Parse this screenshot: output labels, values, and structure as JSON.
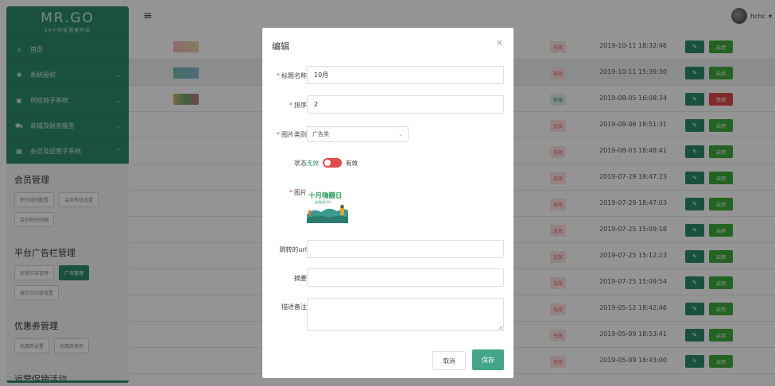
{
  "app": {
    "logo": "MR.GO",
    "tagline": "24小时智慧便利店"
  },
  "topbar": {
    "username": "hchc",
    "dropdown_glyph": "▾"
  },
  "sidebar": {
    "menu": [
      {
        "icon": "home-icon",
        "glyph": "⌂",
        "label": "首页",
        "chevron": ""
      },
      {
        "icon": "gear-icon",
        "glyph": "✱",
        "label": "系统授权",
        "chevron": "⌄"
      },
      {
        "icon": "box-icon",
        "glyph": "▣",
        "label": "供应链子系统",
        "chevron": "⌄"
      },
      {
        "icon": "cart-icon",
        "glyph": "⛟",
        "label": "商城及财务服务",
        "chevron": "⌄"
      },
      {
        "icon": "grid-icon",
        "glyph": "▦",
        "label": "会员及运营子系统",
        "chevron": "⌃"
      }
    ],
    "sections": [
      {
        "title": "会员管理",
        "items": [
          {
            "label": "积分规则配置",
            "active": false
          },
          {
            "label": "会员等级设置",
            "active": false
          },
          {
            "label": "会员积分明细",
            "active": false
          }
        ]
      },
      {
        "title": "平台广告栏管理",
        "items": [
          {
            "label": "运营栏目管理",
            "active": false
          },
          {
            "label": "广告管理",
            "active": true
          },
          {
            "label": "展示位内容设置",
            "active": false
          }
        ]
      },
      {
        "title": "优惠券管理",
        "items": [
          {
            "label": "优惠券设置",
            "active": false
          },
          {
            "label": "优惠券使用",
            "active": false
          }
        ]
      },
      {
        "title": "运营促销活动",
        "items": []
      }
    ]
  },
  "table": {
    "rows": [
      {
        "status": "无效",
        "status_type": "bad",
        "time": "2019-10-11 18:32:46",
        "action": "启用",
        "action_type": "green",
        "thumb": "pink"
      },
      {
        "status": "无效",
        "status_type": "bad",
        "time": "2019-10-11 15:39:30",
        "action": "启用",
        "action_type": "green",
        "thumb": "teal",
        "highlight": true
      },
      {
        "status": "有效",
        "status_type": "good",
        "time": "2019-08-05 16:08:34",
        "action": "禁用",
        "action_type": "red",
        "thumb": "multi"
      },
      {
        "status": "无效",
        "status_type": "bad",
        "time": "2019-08-06 18:51:31",
        "action": "启用",
        "action_type": "green"
      },
      {
        "status": "无效",
        "status_type": "bad",
        "time": "2019-08-03 18:48:41",
        "action": "启用",
        "action_type": "green"
      },
      {
        "status": "无效",
        "status_type": "bad",
        "time": "2019-07-29 18:47:23",
        "action": "启用",
        "action_type": "green"
      },
      {
        "status": "无效",
        "status_type": "bad",
        "time": "2019-07-29 18:47:03",
        "action": "启用",
        "action_type": "green"
      },
      {
        "status": "无效",
        "status_type": "bad",
        "time": "2019-07-25 15:09:18",
        "action": "启用",
        "action_type": "green"
      },
      {
        "status": "无效",
        "status_type": "bad",
        "time": "2019-07-25 15:12:23",
        "action": "启用",
        "action_type": "green"
      },
      {
        "status": "无效",
        "status_type": "bad",
        "time": "2019-07-25 15:09:54",
        "action": "启用",
        "action_type": "green"
      },
      {
        "status": "无效",
        "status_type": "bad",
        "time": "2019-05-12 18:42:46",
        "action": "启用",
        "action_type": "green"
      },
      {
        "status": "无效",
        "status_type": "bad",
        "time": "2019-05-09 18:53:41",
        "action": "启用",
        "action_type": "green"
      },
      {
        "status": "无效",
        "status_type": "bad",
        "time": "2019-05-09 18:43:00",
        "action": "启用",
        "action_type": "green"
      }
    ],
    "edit_glyph": "✎"
  },
  "modal": {
    "title": "编辑",
    "close_glyph": "×",
    "title_label": "标题名称",
    "title_value": "10月",
    "order_label": "排序",
    "order_value": "2",
    "category_label": "图片类别",
    "category_value": "广告类",
    "status_label": "状态",
    "status_off": "无效",
    "status_on": "有效",
    "image_label": "图片",
    "image_text_main": "十月嗨翻日",
    "image_text_sub": "促销进行时",
    "url_label": "跳转的url",
    "url_value": "",
    "summary_label": "摘要",
    "summary_value": "",
    "note_label": "描述备注",
    "note_value": "",
    "cancel_label": "取消",
    "save_label": "保存"
  },
  "colors": {
    "primary": "#2d8c6c",
    "danger": "#e04b4b",
    "success": "#3eab3a"
  }
}
